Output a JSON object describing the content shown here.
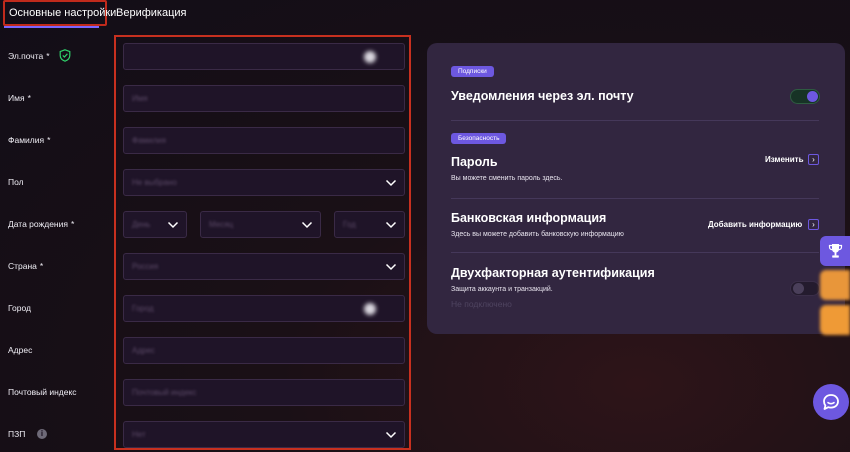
{
  "tabs": {
    "main": "Основные настройки",
    "verify": "Верификация"
  },
  "form": {
    "email": {
      "label": "Эл.почта",
      "required": "*",
      "value": ""
    },
    "first_name": {
      "label": "Имя",
      "required": "*",
      "placeholder": "Имя"
    },
    "last_name": {
      "label": "Фамилия",
      "required": "*",
      "placeholder": "Фамилия"
    },
    "gender": {
      "label": "Пол",
      "placeholder": "Не выбрано"
    },
    "birth": {
      "label": "Дата рождения",
      "required": "*",
      "day": "День",
      "month": "Месяц",
      "year": "Год"
    },
    "country": {
      "label": "Страна",
      "required": "*",
      "value": "Россия"
    },
    "city": {
      "label": "Город",
      "placeholder": "Город"
    },
    "address": {
      "label": "Адрес",
      "placeholder": "Адрес"
    },
    "postal": {
      "label": "Почтовый индекс",
      "placeholder": "Почтовый индекс"
    },
    "pep": {
      "label": "ПЗП",
      "placeholder": "Нет"
    }
  },
  "panel": {
    "subscriptions": {
      "chip": "Подписки",
      "title": "Уведомления через эл. почту",
      "enabled": true
    },
    "security": {
      "chip": "Безопасность",
      "password": {
        "title": "Пароль",
        "desc": "Вы можете сменить пароль здесь.",
        "action": "Изменить"
      },
      "bank": {
        "title": "Банковская информация",
        "desc": "Здесь вы можете добавить банковскую информацию",
        "action": "Добавить информацию"
      },
      "twofa": {
        "title": "Двухфакторная аутентификация",
        "desc": "Защита аккаунта и транзакций.",
        "status": "Не подключено",
        "enabled": false
      }
    }
  },
  "colors": {
    "accent": "#6d58e0",
    "highlight": "#c7301f",
    "panel": "#322640",
    "field": "#1f1428"
  },
  "icons": [
    "shield-check-icon",
    "info-icon",
    "chevron-down-icon",
    "chevron-right-icon",
    "trophy-icon",
    "chat-icon"
  ]
}
